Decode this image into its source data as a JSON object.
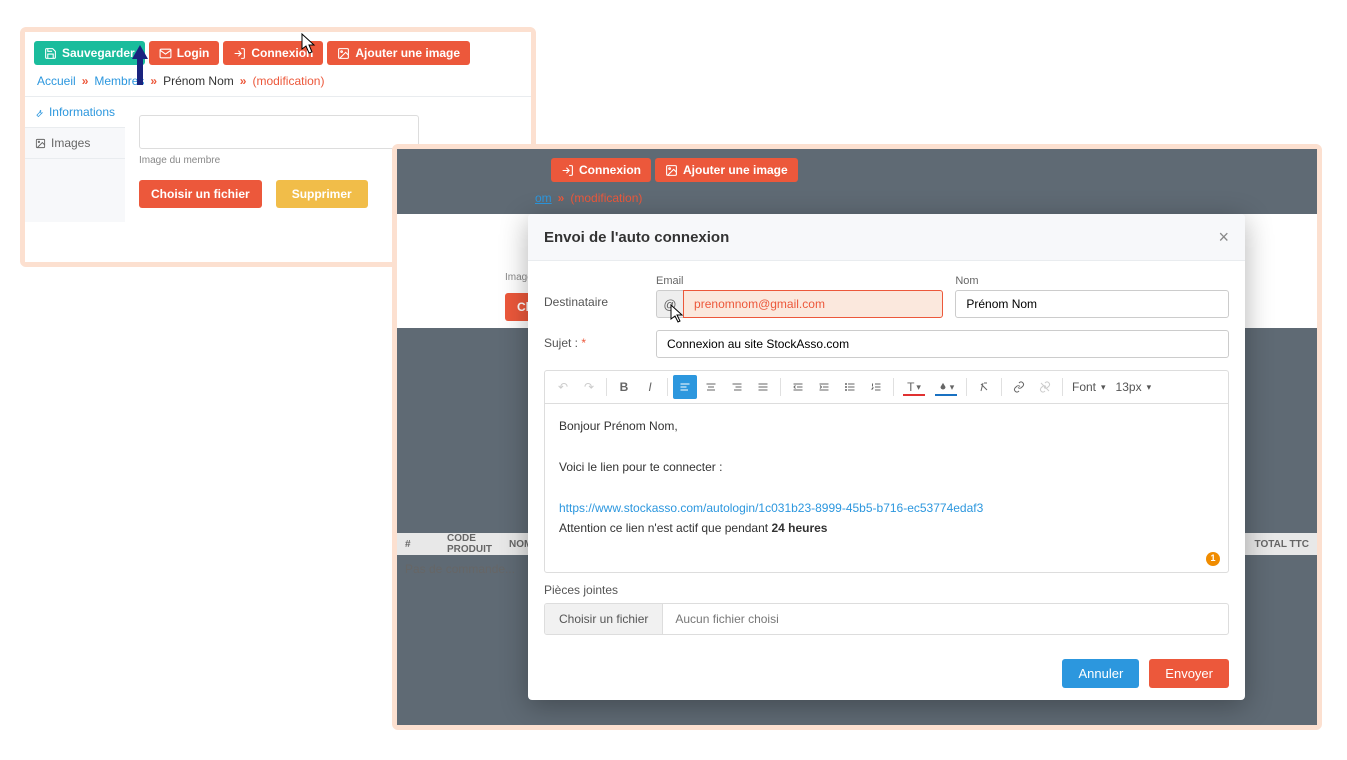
{
  "panel1": {
    "toolbar": {
      "save": "Sauvegarder",
      "login": "Login",
      "connexion": "Connexion",
      "add_image": "Ajouter une image"
    },
    "breadcrumb": {
      "home": "Accueil",
      "members": "Membres",
      "name": "Prénom Nom",
      "modification": "(modification)"
    },
    "tabs": {
      "informations": "Informations",
      "images": "Images"
    },
    "form": {
      "help": "Image du membre",
      "choose": "Choisir un fichier",
      "delete": "Supprimer"
    }
  },
  "panel2": {
    "toolbar": {
      "connexion": "Connexion",
      "add_image": "Ajouter une image"
    },
    "breadcrumb": {
      "nom": "om",
      "modification": "(modification)"
    },
    "form_strip": {
      "help": "Image du",
      "choose": "Choi"
    },
    "table": {
      "col_num": "#",
      "col_code": "CODE PRODUIT",
      "col_nom": "NOM P",
      "col_total": "TOTAL TTC",
      "empty": "Pas de commande..."
    }
  },
  "modal": {
    "title": "Envoi de l'auto connexion",
    "labels": {
      "destinataire": "Destinataire",
      "email": "Email",
      "nom": "Nom",
      "sujet": "Sujet :",
      "pieces_jointes": "Pièces jointes"
    },
    "values": {
      "email": "prenomnom@gmail.com",
      "nom": "Prénom Nom",
      "sujet": "Connexion au site StockAsso.com"
    },
    "rte": {
      "font_label": "Font",
      "size_label": "13px",
      "greeting": "Bonjour Prénom Nom,",
      "intro": "Voici le lien pour te connecter :",
      "link": "https://www.stockasso.com/autologin/1c031b23-8999-45b5-b716-ec53774edaf3",
      "warning_prefix": "Attention ce lien n'est actif que pendant ",
      "warning_bold": "24 heures",
      "badge": "1"
    },
    "attach": {
      "choose": "Choisir un fichier",
      "none": "Aucun fichier choisi"
    },
    "footer": {
      "cancel": "Annuler",
      "send": "Envoyer"
    }
  }
}
